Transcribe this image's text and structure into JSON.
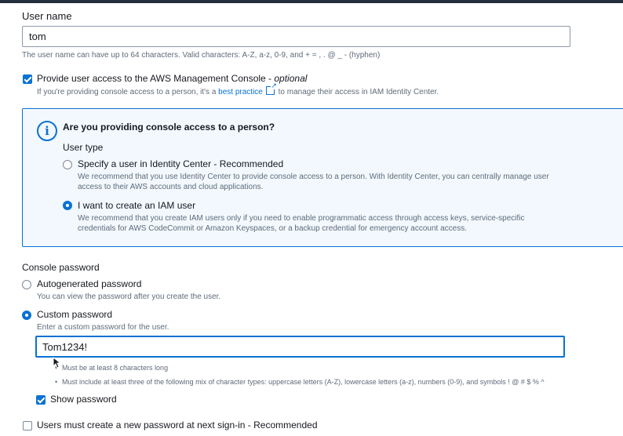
{
  "username": {
    "label": "User name",
    "value": "tom",
    "hint": "The user name can have up to 64 characters. Valid characters: A-Z, a-z, 0-9, and + = , . @ _ - (hyphen)"
  },
  "console_access": {
    "checked": true,
    "label": "Provide user access to the AWS Management Console - ",
    "label_optional": "optional",
    "desc_before": "If you're providing console access to a person, it's a ",
    "link": "best practice",
    "desc_after": " to manage their access in IAM Identity Center."
  },
  "info_panel": {
    "question": "Are you providing console access to a person?",
    "user_type_label": "User type",
    "options": [
      {
        "label": "Specify a user in Identity Center - Recommended",
        "desc1": "We recommend that you use Identity Center to provide console access to a person. With Identity Center, you can centrally manage user",
        "desc2": "access to their AWS accounts and cloud applications.",
        "selected": false
      },
      {
        "label": "I want to create an IAM user",
        "desc1": "We recommend that you create IAM users only if you need to enable programmatic access through access keys, service-specific",
        "desc2": "credentials for AWS CodeCommit or Amazon Keyspaces, or a backup credential for emergency account access.",
        "selected": true
      }
    ]
  },
  "console_password": {
    "label": "Console password",
    "options": [
      {
        "label": "Autogenerated password",
        "desc": "You can view the password after you create the user.",
        "selected": false
      },
      {
        "label": "Custom password",
        "desc": "Enter a custom password for the user.",
        "selected": true
      }
    ],
    "password_value": "Tom1234!",
    "requirements": [
      "Must be at least 8 characters long",
      "Must include at least three of the following mix of character types: uppercase letters (A-Z), lowercase letters (a-z), numbers (0-9), and symbols ! @ # $ % ^"
    ],
    "show_password_label": "Show password",
    "show_password_checked": true
  },
  "reset_required": {
    "label": "Users must create a new password at next sign-in - Recommended",
    "checked": false
  },
  "colors": {
    "accent": "#0972d3",
    "info_bg": "#f2f8fd",
    "text": "#16191f",
    "muted": "#5f6b7a"
  }
}
